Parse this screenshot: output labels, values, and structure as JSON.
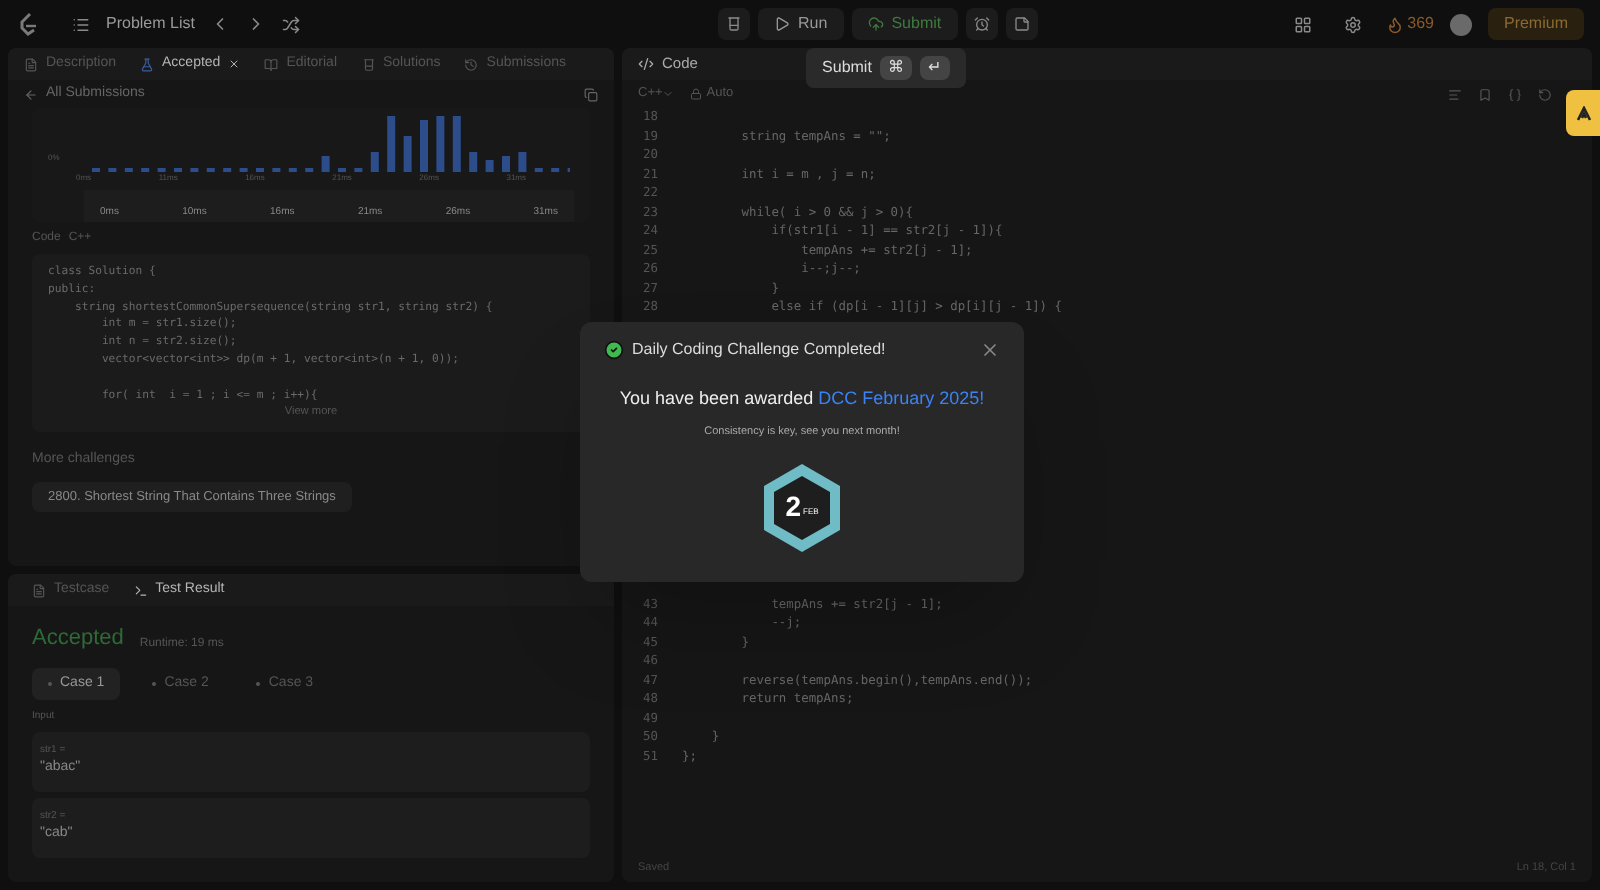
{
  "top_bar": {
    "title": "Problem List",
    "run": "Run",
    "submit": "Submit",
    "streak": "369",
    "premium": "Premium"
  },
  "tooltip": {
    "label": "Submit",
    "keys": [
      "⌘",
      "↵"
    ]
  },
  "left_tabs": [
    {
      "label": "Description",
      "selected": false
    },
    {
      "label": "Accepted",
      "selected": true
    },
    {
      "label": "Editorial",
      "selected": false
    },
    {
      "label": "Solutions",
      "selected": false
    },
    {
      "label": "Submissions",
      "selected": false
    }
  ],
  "submission": {
    "back_label": "All Submissions",
    "y_label": "0%",
    "x_labels": [
      "0ms",
      "11ms",
      "16ms",
      "21ms",
      "26ms",
      "31ms"
    ],
    "mini_labels": [
      "0ms",
      "10ms",
      "16ms",
      "21ms",
      "26ms",
      "31ms"
    ],
    "code_heading": "Code",
    "code_language": "C++",
    "code_lines": [
      "class Solution {",
      "public:",
      "    string shortestCommonSupersequence(string str1, string str2) {",
      "        int m = str1.size();",
      "        int n = str2.size();",
      "        vector<vector<int>> dp(m + 1, vector<int>(n + 1, 0));"
    ],
    "code_lines_after_blank": [
      "        for( int  i = 1 ; i <= m ; i++){"
    ],
    "view_more": "View more",
    "more_heading": "More challenges",
    "challenge": "2800. Shortest String That Contains Three Strings"
  },
  "bottom_tabs": [
    {
      "label": "Testcase",
      "selected": false
    },
    {
      "label": "Test Result",
      "selected": true
    }
  ],
  "result": {
    "status": "Accepted",
    "runtime": "Runtime: 19 ms",
    "cases": [
      {
        "label": "Case 1",
        "selected": true
      },
      {
        "label": "Case 2",
        "selected": false
      },
      {
        "label": "Case 3",
        "selected": false
      }
    ],
    "input_label": "Input",
    "inputs": [
      {
        "name": "str1 =",
        "value": "\"abac\""
      },
      {
        "name": "str2 =",
        "value": "\"cab\""
      }
    ]
  },
  "editor": {
    "tab": "Code",
    "language": "C++",
    "mode": "Auto",
    "lines_top": [
      {
        "n": "18"
      },
      {
        "n": "19",
        "code": "        string tempAns = \"\";"
      },
      {
        "n": "20"
      },
      {
        "n": "21",
        "code": "        int i = m , j = n;"
      },
      {
        "n": "22"
      },
      {
        "n": "23",
        "code": "        while( i > 0 && j > 0){"
      },
      {
        "n": "24",
        "code": "            if(str1[i - 1] == str2[j - 1]){"
      },
      {
        "n": "25",
        "code": "                tempAns += str2[j - 1];"
      },
      {
        "n": "26",
        "code": "                i--;j--;"
      },
      {
        "n": "27",
        "code": "            }"
      },
      {
        "n": "28",
        "code": "            else if (dp[i - 1][j] > dp[i][j - 1]) {"
      }
    ],
    "lines_bottom": [
      {
        "n": "43",
        "code": "            tempAns += str2[j - 1];"
      },
      {
        "n": "44",
        "code": "            --j;"
      },
      {
        "n": "45",
        "code": "        }"
      },
      {
        "n": "46"
      },
      {
        "n": "47",
        "code": "        reverse(tempAns.begin(),tempAns.end());"
      },
      {
        "n": "48",
        "code": "        return tempAns;"
      },
      {
        "n": "49"
      },
      {
        "n": "50",
        "code": "    }"
      },
      {
        "n": "51",
        "code": "};"
      }
    ],
    "status": "Saved",
    "position": "Ln 18, Col 1"
  },
  "modal": {
    "title": "Daily Coding Challenge Completed!",
    "awarded": "You have been awarded",
    "award": "DCC February 2025!",
    "subtitle": "Consistency is key, see you next month!",
    "badge_number": "2",
    "badge_month": "FEB"
  }
}
